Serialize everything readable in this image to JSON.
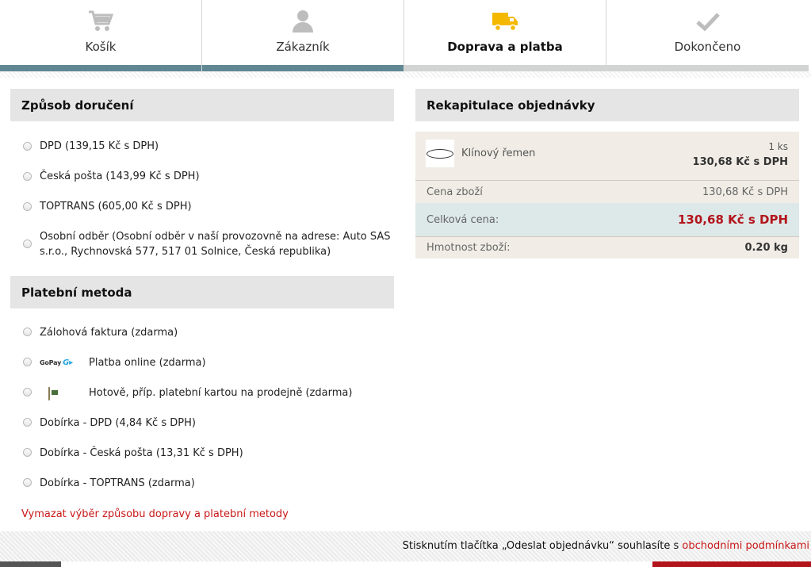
{
  "steps": [
    {
      "label": "Košík",
      "icon": "cart-icon",
      "state": "done"
    },
    {
      "label": "Zákazník",
      "icon": "user-icon",
      "state": "done"
    },
    {
      "label": "Doprava a platba",
      "icon": "truck-icon",
      "state": "active"
    },
    {
      "label": "Dokončeno",
      "icon": "check-icon",
      "state": "pending"
    }
  ],
  "delivery": {
    "title": "Způsob doručení",
    "options": [
      "DPD (139,15 Kč s DPH)",
      "Česká pošta (143,99 Kč s DPH)",
      "TOPTRANS (605,00 Kč s DPH)",
      "Osobní odběr (Osobní odběr v naší provozovně na adrese: Auto SAS s.r.o., Rychnovská 577, 517 01 Solnice, Česká republika)"
    ]
  },
  "payment": {
    "title": "Platební metoda",
    "options": [
      {
        "label": "Zálohová faktura (zdarma)",
        "logo": ""
      },
      {
        "label": "Platba online (zdarma)",
        "logo": "gopay-logo",
        "logo_text": "GoPay"
      },
      {
        "label": "Hotově, příp. platební kartou na prodejně (zdarma)",
        "logo": "card-terminal-icon"
      },
      {
        "label": "Dobírka - DPD (4,84 Kč s DPH)",
        "logo": ""
      },
      {
        "label": "Dobírka - Česká pošta (13,31 Kč s DPH)",
        "logo": ""
      },
      {
        "label": "Dobírka - TOPTRANS (zdarma)",
        "logo": ""
      }
    ],
    "clear_link": "Vymazat výběr způsobu dopravy a platební metody"
  },
  "summary": {
    "title": "Rekapitulace objednávky",
    "item": {
      "name": "Klínový řemen",
      "qty": "1 ks",
      "price": "130,68 Kč s DPH"
    },
    "goods_label": "Cena zboží",
    "goods_value": "130,68 Kč s DPH",
    "total_label": "Celková cena:",
    "total_value": "130,68 Kč s DPH",
    "weight_label": "Hmotnost zboží:",
    "weight_value": "0.20 kg"
  },
  "footer": {
    "terms_text": "Stisknutím tlačítka „Odeslat objednávku“ souhlasíte s ",
    "terms_link": "obchodními podmínkami"
  },
  "colors": {
    "progress_done": "#5f8893",
    "progress_pending": "#d2d4d4",
    "accent_red": "#b3141b",
    "truck_yellow": "#f5b800"
  }
}
